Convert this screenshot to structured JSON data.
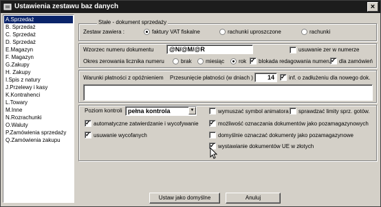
{
  "window": {
    "title": "Ustawienia zestawu baz danych",
    "close_glyph": "×"
  },
  "sidebar": {
    "items": [
      {
        "label": "A.Sprzedaż",
        "selected": true
      },
      {
        "label": "B.  Sprzedaż"
      },
      {
        "label": "C.  Sprzedaż"
      },
      {
        "label": "D.  Sprzedaż"
      },
      {
        "label": "E.Magazyn"
      },
      {
        "label": "F.  Magazyn"
      },
      {
        "label": "G.Zakupy"
      },
      {
        "label": "H.  Zakupy"
      },
      {
        "label": "I.Spis z natury"
      },
      {
        "label": "J.Przelewy i kasy"
      },
      {
        "label": "K.Kontrahenci"
      },
      {
        "label": "L.Towary"
      },
      {
        "label": "M.Inne"
      },
      {
        "label": "N.Rozrachunki"
      },
      {
        "label": "O.Waluty"
      },
      {
        "label": "P.Zamówienia sprzedaży"
      },
      {
        "label": "Q.Zamówienia zakupu"
      }
    ]
  },
  "fixed": {
    "title": "Stałe - dokument sprzedaży",
    "set_label": "Zestaw zawiera :",
    "opt1": "faktury VAT fiskalne",
    "opt2": "rachunki uproszczone",
    "opt3": "rachunki"
  },
  "numbering": {
    "pattern_label": "Wzorzec numeru dokumentu",
    "pattern_value": "@N/@M/@R",
    "remove_zeros": "usuwanie zer w numerze",
    "reset_label": "Okres zerowania licznika numeru",
    "reset_none": "brak",
    "reset_month": "miesiąc",
    "reset_year": "rok",
    "block_edit": "blokada redagowania numeru",
    "for_orders": "dla zamówień"
  },
  "payment": {
    "delayed_label": "Warunki płatności z opóźnieniem",
    "shift_label": "Przesunięcie płatności (w dniach )",
    "shift_value": "14",
    "debt_info": "inf. o zadłużeniu dla nowego dok."
  },
  "control": {
    "level_label": "Poziom kontroli",
    "level_value": "pełna kontrola",
    "force_animator": "wymuszać symbol animatora",
    "check_limits": "sprawdzać limity sprz. gotów.",
    "auto_approve": "automatyczne zatwierdzanie i wycofywanie",
    "mark_offwarehouse": "możliwość oznaczania dokumentów jako pozamagazynowych",
    "remove_withdrawn": "usuwanie wycofanych",
    "default_offwarehouse": "domyślnie oznaczać dokumenty jako pozamagazynowe",
    "eu_docs_pln": "wystawianie dokumentów UE w złotych"
  },
  "buttons": {
    "default": "Ustaw jako domyślne",
    "cancel": "Anuluj"
  }
}
